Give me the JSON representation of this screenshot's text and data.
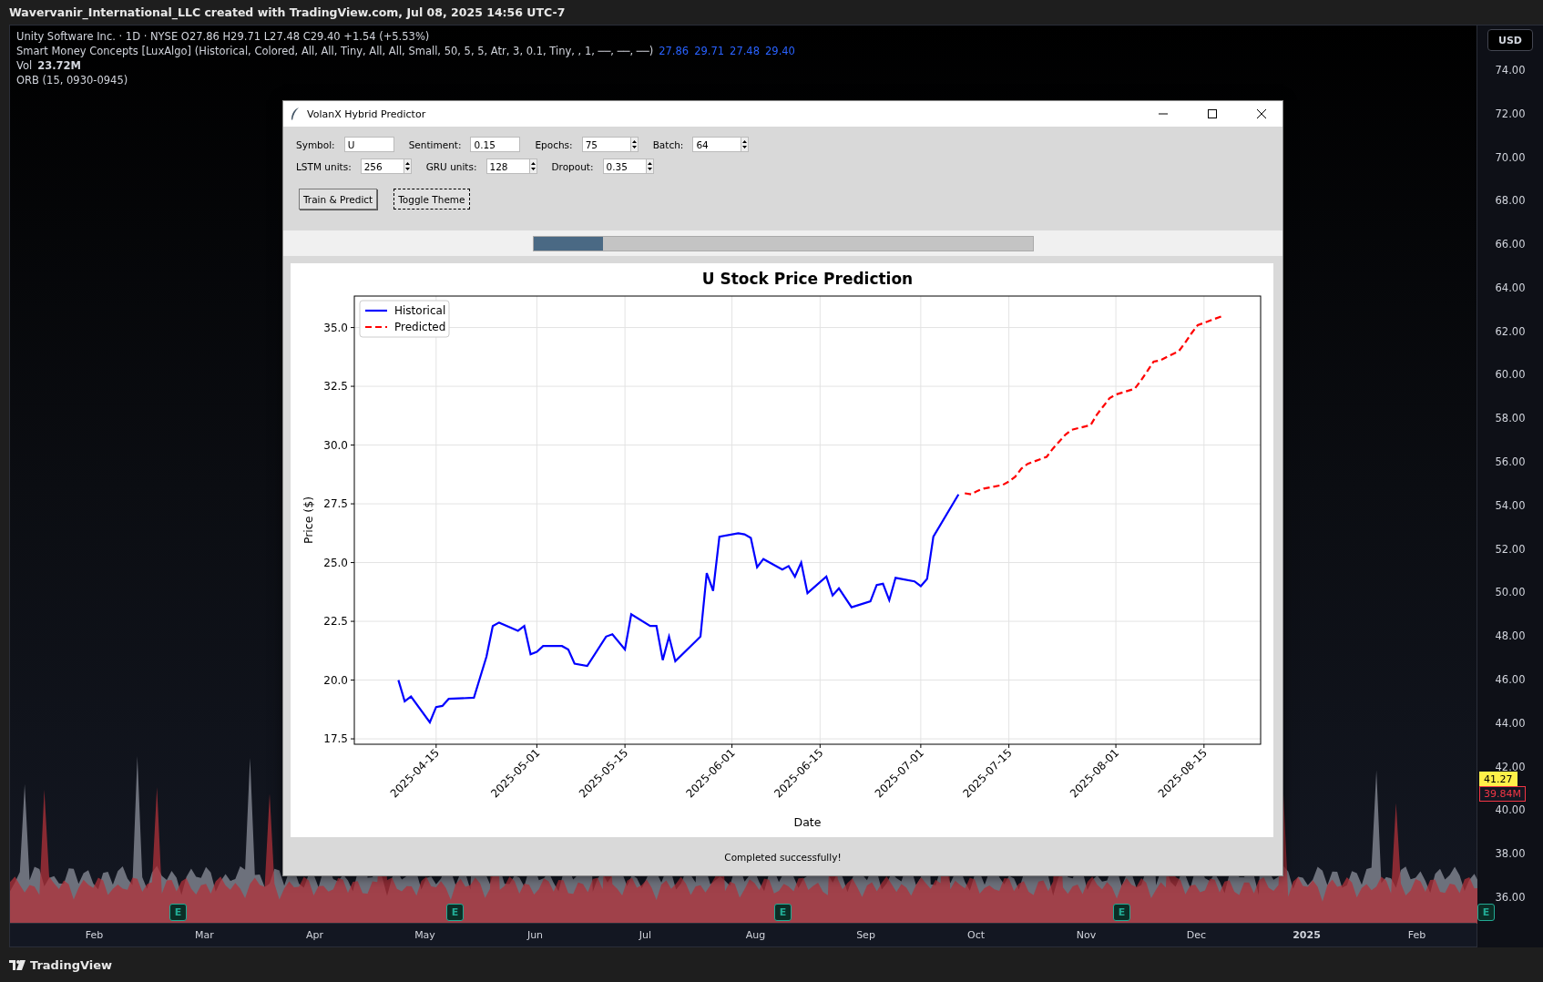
{
  "header": {
    "text": "Wavervanir_International_LLC created with TradingView.com, Jul 08, 2025 14:56 UTC-7"
  },
  "legend": {
    "symbol_line": "Unity Software Inc. · 1D · NYSE  O27.86  H29.71  L27.48  C29.40  +1.54 (+5.53%)",
    "indicator": "Smart Money Concepts [LuxAlgo] (Historical, Colored, All, All, Tiny, All, All, Small, 50, 5, 5, Atr, 3, 0.1, Tiny, , 1, ──, ──, ──)",
    "indicator_values": [
      "27.86",
      "29.71",
      "27.48",
      "29.40"
    ],
    "volume_label": "Vol",
    "volume_value": "23.72M",
    "orb": "ORB (15, 0930-0945)"
  },
  "price_axis": {
    "currency": "USD",
    "labels": [
      "74.00",
      "72.00",
      "70.00",
      "68.00",
      "66.00",
      "64.00",
      "62.00",
      "60.00",
      "58.00",
      "56.00",
      "54.00",
      "52.00",
      "50.00",
      "48.00",
      "46.00",
      "44.00",
      "42.00",
      "40.00",
      "38.00",
      "36.00"
    ],
    "price_tag": "41.27",
    "volume_tag": "39.84M"
  },
  "time_axis": [
    {
      "label": "Feb",
      "year": false
    },
    {
      "label": "Mar",
      "year": false
    },
    {
      "label": "Apr",
      "year": false
    },
    {
      "label": "May",
      "year": false
    },
    {
      "label": "Jun",
      "year": false
    },
    {
      "label": "Jul",
      "year": false
    },
    {
      "label": "Aug",
      "year": false
    },
    {
      "label": "Sep",
      "year": false
    },
    {
      "label": "Oct",
      "year": false
    },
    {
      "label": "Nov",
      "year": false
    },
    {
      "label": "Dec",
      "year": false
    },
    {
      "label": "2025",
      "year": true
    },
    {
      "label": "Feb",
      "year": false
    }
  ],
  "earnings_badges": [
    "E",
    "E",
    "E",
    "E",
    "E"
  ],
  "footer": {
    "brand": "TradingView"
  },
  "app_window": {
    "title": "VolanX Hybrid Predictor",
    "control_rows": [
      [
        {
          "kind": "entry",
          "label": "Symbol:",
          "value": "U"
        },
        {
          "kind": "entry",
          "label": "Sentiment:",
          "value": "0.15"
        },
        {
          "kind": "spinbox",
          "label": "Epochs:",
          "value": "75"
        },
        {
          "kind": "spinbox",
          "label": "Batch:",
          "value": "64"
        }
      ],
      [
        {
          "kind": "spinbox",
          "label": "LSTM units:",
          "value": "256"
        },
        {
          "kind": "spinbox",
          "label": "GRU units:",
          "value": "128"
        },
        {
          "kind": "spinbox",
          "label": "Dropout:",
          "value": "0.35"
        }
      ]
    ],
    "buttons": [
      {
        "label": "Train & Predict",
        "focused": false
      },
      {
        "label": "Toggle Theme",
        "focused": true
      }
    ],
    "progress": {
      "level": 0.14
    },
    "chart_data": {
      "type": "line",
      "title": "U Stock Price Prediction",
      "xlabel": "Date",
      "ylabel": "Price ($)",
      "x": [
        "2025-04-09",
        "2025-04-10",
        "2025-04-11",
        "2025-04-14",
        "2025-04-15",
        "2025-04-16",
        "2025-04-17",
        "2025-04-21",
        "2025-04-23",
        "2025-04-24",
        "2025-04-25",
        "2025-04-28",
        "2025-04-29",
        "2025-04-30",
        "2025-05-01",
        "2025-05-02",
        "2025-05-05",
        "2025-05-06",
        "2025-05-07",
        "2025-05-09",
        "2025-05-12",
        "2025-05-13",
        "2025-05-15",
        "2025-05-16",
        "2025-05-19",
        "2025-05-20",
        "2025-05-21",
        "2025-05-22",
        "2025-05-23",
        "2025-05-27",
        "2025-05-28",
        "2025-05-29",
        "2025-05-30",
        "2025-06-02",
        "2025-06-03",
        "2025-06-04",
        "2025-06-05",
        "2025-06-06",
        "2025-06-09",
        "2025-06-10",
        "2025-06-11",
        "2025-06-12",
        "2025-06-13",
        "2025-06-16",
        "2025-06-17",
        "2025-06-18",
        "2025-06-20",
        "2025-06-23",
        "2025-06-24",
        "2025-06-25",
        "2025-06-26",
        "2025-06-27",
        "2025-06-30",
        "2025-07-01",
        "2025-07-02",
        "2025-07-03",
        "2025-07-07",
        "2025-07-08",
        "2025-07-09",
        "2025-07-10",
        "2025-07-11",
        "2025-07-14",
        "2025-07-15",
        "2025-07-16",
        "2025-07-17",
        "2025-07-18",
        "2025-07-21",
        "2025-07-22",
        "2025-07-23",
        "2025-07-24",
        "2025-07-25",
        "2025-07-28",
        "2025-07-29",
        "2025-07-30",
        "2025-07-31",
        "2025-08-01",
        "2025-08-04",
        "2025-08-05",
        "2025-08-06",
        "2025-08-07",
        "2025-08-08",
        "2025-08-11",
        "2025-08-12",
        "2025-08-13",
        "2025-08-14",
        "2025-08-15",
        "2025-08-18"
      ],
      "series": [
        {
          "name": "Historical",
          "color": "#0000ff",
          "line_style": "solid",
          "values": [
            20.0,
            19.1,
            19.3,
            18.2,
            18.85,
            18.9,
            19.2,
            19.25,
            21.0,
            22.3,
            22.45,
            22.1,
            22.3,
            21.1,
            21.2,
            21.45,
            21.45,
            21.3,
            20.7,
            20.6,
            21.85,
            21.95,
            21.3,
            22.8,
            22.3,
            22.3,
            20.85,
            21.85,
            20.8,
            21.85,
            24.55,
            23.8,
            26.1,
            26.25,
            26.2,
            26.05,
            24.8,
            25.15,
            24.7,
            24.85,
            24.4,
            25.0,
            23.7,
            24.4,
            23.6,
            23.9,
            23.1,
            23.35,
            24.05,
            24.1,
            23.4,
            24.35,
            24.2,
            24.0,
            24.3,
            26.1,
            27.9,
            null,
            null,
            null,
            null,
            null,
            null,
            null,
            null,
            null,
            null,
            null,
            null,
            null,
            null,
            null,
            null,
            null,
            null,
            null,
            null,
            null,
            null,
            null,
            null,
            null,
            null,
            null,
            null,
            null,
            null
          ]
        },
        {
          "name": "Predicted",
          "color": "#ff0000",
          "line_style": "dashed",
          "values": [
            null,
            null,
            null,
            null,
            null,
            null,
            null,
            null,
            null,
            null,
            null,
            null,
            null,
            null,
            null,
            null,
            null,
            null,
            null,
            null,
            null,
            null,
            null,
            null,
            null,
            null,
            null,
            null,
            null,
            null,
            null,
            null,
            null,
            null,
            null,
            null,
            null,
            null,
            null,
            null,
            null,
            null,
            null,
            null,
            null,
            null,
            null,
            null,
            null,
            null,
            null,
            null,
            null,
            null,
            null,
            null,
            null,
            27.95,
            27.9,
            28.05,
            28.15,
            28.3,
            28.45,
            28.65,
            29.0,
            29.2,
            29.5,
            29.85,
            30.15,
            30.45,
            30.65,
            30.85,
            31.3,
            31.65,
            32.0,
            32.15,
            32.4,
            32.75,
            33.15,
            33.55,
            33.6,
            34.0,
            34.35,
            34.75,
            35.1,
            35.2,
            35.5
          ]
        }
      ],
      "grid": true,
      "legend": true,
      "xlim": [
        "2025-04-02",
        "2025-08-24"
      ],
      "ylim": [
        17.27,
        36.34
      ],
      "xticks": [
        {
          "value": "2025-04-15",
          "label": "2025-04-15"
        },
        {
          "value": "2025-05-01",
          "label": "2025-05-01"
        },
        {
          "value": "2025-05-15",
          "label": "2025-05-15"
        },
        {
          "value": "2025-06-01",
          "label": "2025-06-01"
        },
        {
          "value": "2025-06-15",
          "label": "2025-06-15"
        },
        {
          "value": "2025-07-01",
          "label": "2025-07-01"
        },
        {
          "value": "2025-07-15",
          "label": "2025-07-15"
        },
        {
          "value": "2025-08-01",
          "label": "2025-08-01"
        },
        {
          "value": "2025-08-15",
          "label": "2025-08-15"
        }
      ],
      "yticks": [
        {
          "value": 17.5,
          "label": "17.5"
        },
        {
          "value": 20,
          "label": "20.0"
        },
        {
          "value": 22.5,
          "label": "22.5"
        },
        {
          "value": 25,
          "label": "25.0"
        },
        {
          "value": 27.5,
          "label": "27.5"
        },
        {
          "value": 30,
          "label": "30.0"
        },
        {
          "value": 32.5,
          "label": "32.5"
        },
        {
          "value": 35,
          "label": "35.0"
        }
      ]
    },
    "status": "Completed successfully!"
  }
}
